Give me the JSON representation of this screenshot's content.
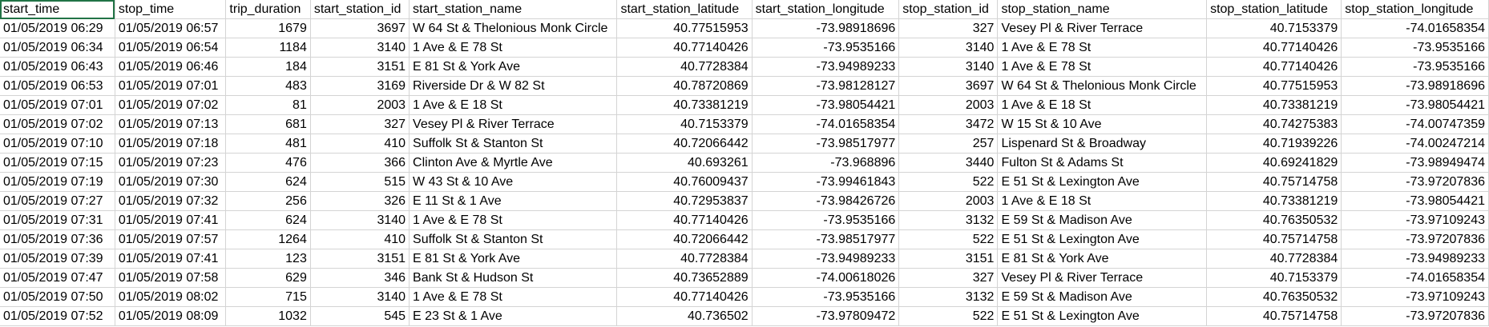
{
  "columns": [
    {
      "label": "start_time",
      "align": "txt"
    },
    {
      "label": "stop_time",
      "align": "txt"
    },
    {
      "label": "trip_duration",
      "align": "num"
    },
    {
      "label": "start_station_id",
      "align": "num"
    },
    {
      "label": "start_station_name",
      "align": "txt"
    },
    {
      "label": "start_station_latitude",
      "align": "num"
    },
    {
      "label": "start_station_longitude",
      "align": "num"
    },
    {
      "label": "stop_station_id",
      "align": "num"
    },
    {
      "label": "stop_station_name",
      "align": "txt"
    },
    {
      "label": "stop_station_latitude",
      "align": "num"
    },
    {
      "label": "stop_station_longitude",
      "align": "num"
    }
  ],
  "rows": [
    [
      "01/05/2019 06:29",
      "01/05/2019 06:57",
      "1679",
      "3697",
      "W 64 St & Thelonious Monk Circle",
      "40.77515953",
      "-73.98918696",
      "327",
      "Vesey Pl & River Terrace",
      "40.7153379",
      "-74.01658354"
    ],
    [
      "01/05/2019 06:34",
      "01/05/2019 06:54",
      "1184",
      "3140",
      "1 Ave & E 78 St",
      "40.77140426",
      "-73.9535166",
      "3140",
      "1 Ave & E 78 St",
      "40.77140426",
      "-73.9535166"
    ],
    [
      "01/05/2019 06:43",
      "01/05/2019 06:46",
      "184",
      "3151",
      "E 81 St & York Ave",
      "40.7728384",
      "-73.94989233",
      "3140",
      "1 Ave & E 78 St",
      "40.77140426",
      "-73.9535166"
    ],
    [
      "01/05/2019 06:53",
      "01/05/2019 07:01",
      "483",
      "3169",
      "Riverside Dr & W 82 St",
      "40.78720869",
      "-73.98128127",
      "3697",
      "W 64 St & Thelonious Monk Circle",
      "40.77515953",
      "-73.98918696"
    ],
    [
      "01/05/2019 07:01",
      "01/05/2019 07:02",
      "81",
      "2003",
      "1 Ave & E 18 St",
      "40.73381219",
      "-73.98054421",
      "2003",
      "1 Ave & E 18 St",
      "40.73381219",
      "-73.98054421"
    ],
    [
      "01/05/2019 07:02",
      "01/05/2019 07:13",
      "681",
      "327",
      "Vesey Pl & River Terrace",
      "40.7153379",
      "-74.01658354",
      "3472",
      "W 15 St & 10 Ave",
      "40.74275383",
      "-74.00747359"
    ],
    [
      "01/05/2019 07:10",
      "01/05/2019 07:18",
      "481",
      "410",
      "Suffolk St & Stanton St",
      "40.72066442",
      "-73.98517977",
      "257",
      "Lispenard St & Broadway",
      "40.71939226",
      "-74.00247214"
    ],
    [
      "01/05/2019 07:15",
      "01/05/2019 07:23",
      "476",
      "366",
      "Clinton Ave & Myrtle Ave",
      "40.693261",
      "-73.968896",
      "3440",
      "Fulton St & Adams St",
      "40.69241829",
      "-73.98949474"
    ],
    [
      "01/05/2019 07:19",
      "01/05/2019 07:30",
      "624",
      "515",
      "W 43 St & 10 Ave",
      "40.76009437",
      "-73.99461843",
      "522",
      "E 51 St & Lexington Ave",
      "40.75714758",
      "-73.97207836"
    ],
    [
      "01/05/2019 07:27",
      "01/05/2019 07:32",
      "256",
      "326",
      "E 11 St & 1 Ave",
      "40.72953837",
      "-73.98426726",
      "2003",
      "1 Ave & E 18 St",
      "40.73381219",
      "-73.98054421"
    ],
    [
      "01/05/2019 07:31",
      "01/05/2019 07:41",
      "624",
      "3140",
      "1 Ave & E 78 St",
      "40.77140426",
      "-73.9535166",
      "3132",
      "E 59 St & Madison Ave",
      "40.76350532",
      "-73.97109243"
    ],
    [
      "01/05/2019 07:36",
      "01/05/2019 07:57",
      "1264",
      "410",
      "Suffolk St & Stanton St",
      "40.72066442",
      "-73.98517977",
      "522",
      "E 51 St & Lexington Ave",
      "40.75714758",
      "-73.97207836"
    ],
    [
      "01/05/2019 07:39",
      "01/05/2019 07:41",
      "123",
      "3151",
      "E 81 St & York Ave",
      "40.7728384",
      "-73.94989233",
      "3151",
      "E 81 St & York Ave",
      "40.7728384",
      "-73.94989233"
    ],
    [
      "01/05/2019 07:47",
      "01/05/2019 07:58",
      "629",
      "346",
      "Bank St & Hudson St",
      "40.73652889",
      "-74.00618026",
      "327",
      "Vesey Pl & River Terrace",
      "40.7153379",
      "-74.01658354"
    ],
    [
      "01/05/2019 07:50",
      "01/05/2019 08:02",
      "715",
      "3140",
      "1 Ave & E 78 St",
      "40.77140426",
      "-73.9535166",
      "3132",
      "E 59 St & Madison Ave",
      "40.76350532",
      "-73.97109243"
    ],
    [
      "01/05/2019 07:52",
      "01/05/2019 08:09",
      "1032",
      "545",
      "E 23 St & 1 Ave",
      "40.736502",
      "-73.97809472",
      "522",
      "E 51 St & Lexington Ave",
      "40.75714758",
      "-73.97207836"
    ]
  ],
  "colors": {
    "gridline": "#d4d4d4",
    "active_cell_border": "#217346"
  }
}
